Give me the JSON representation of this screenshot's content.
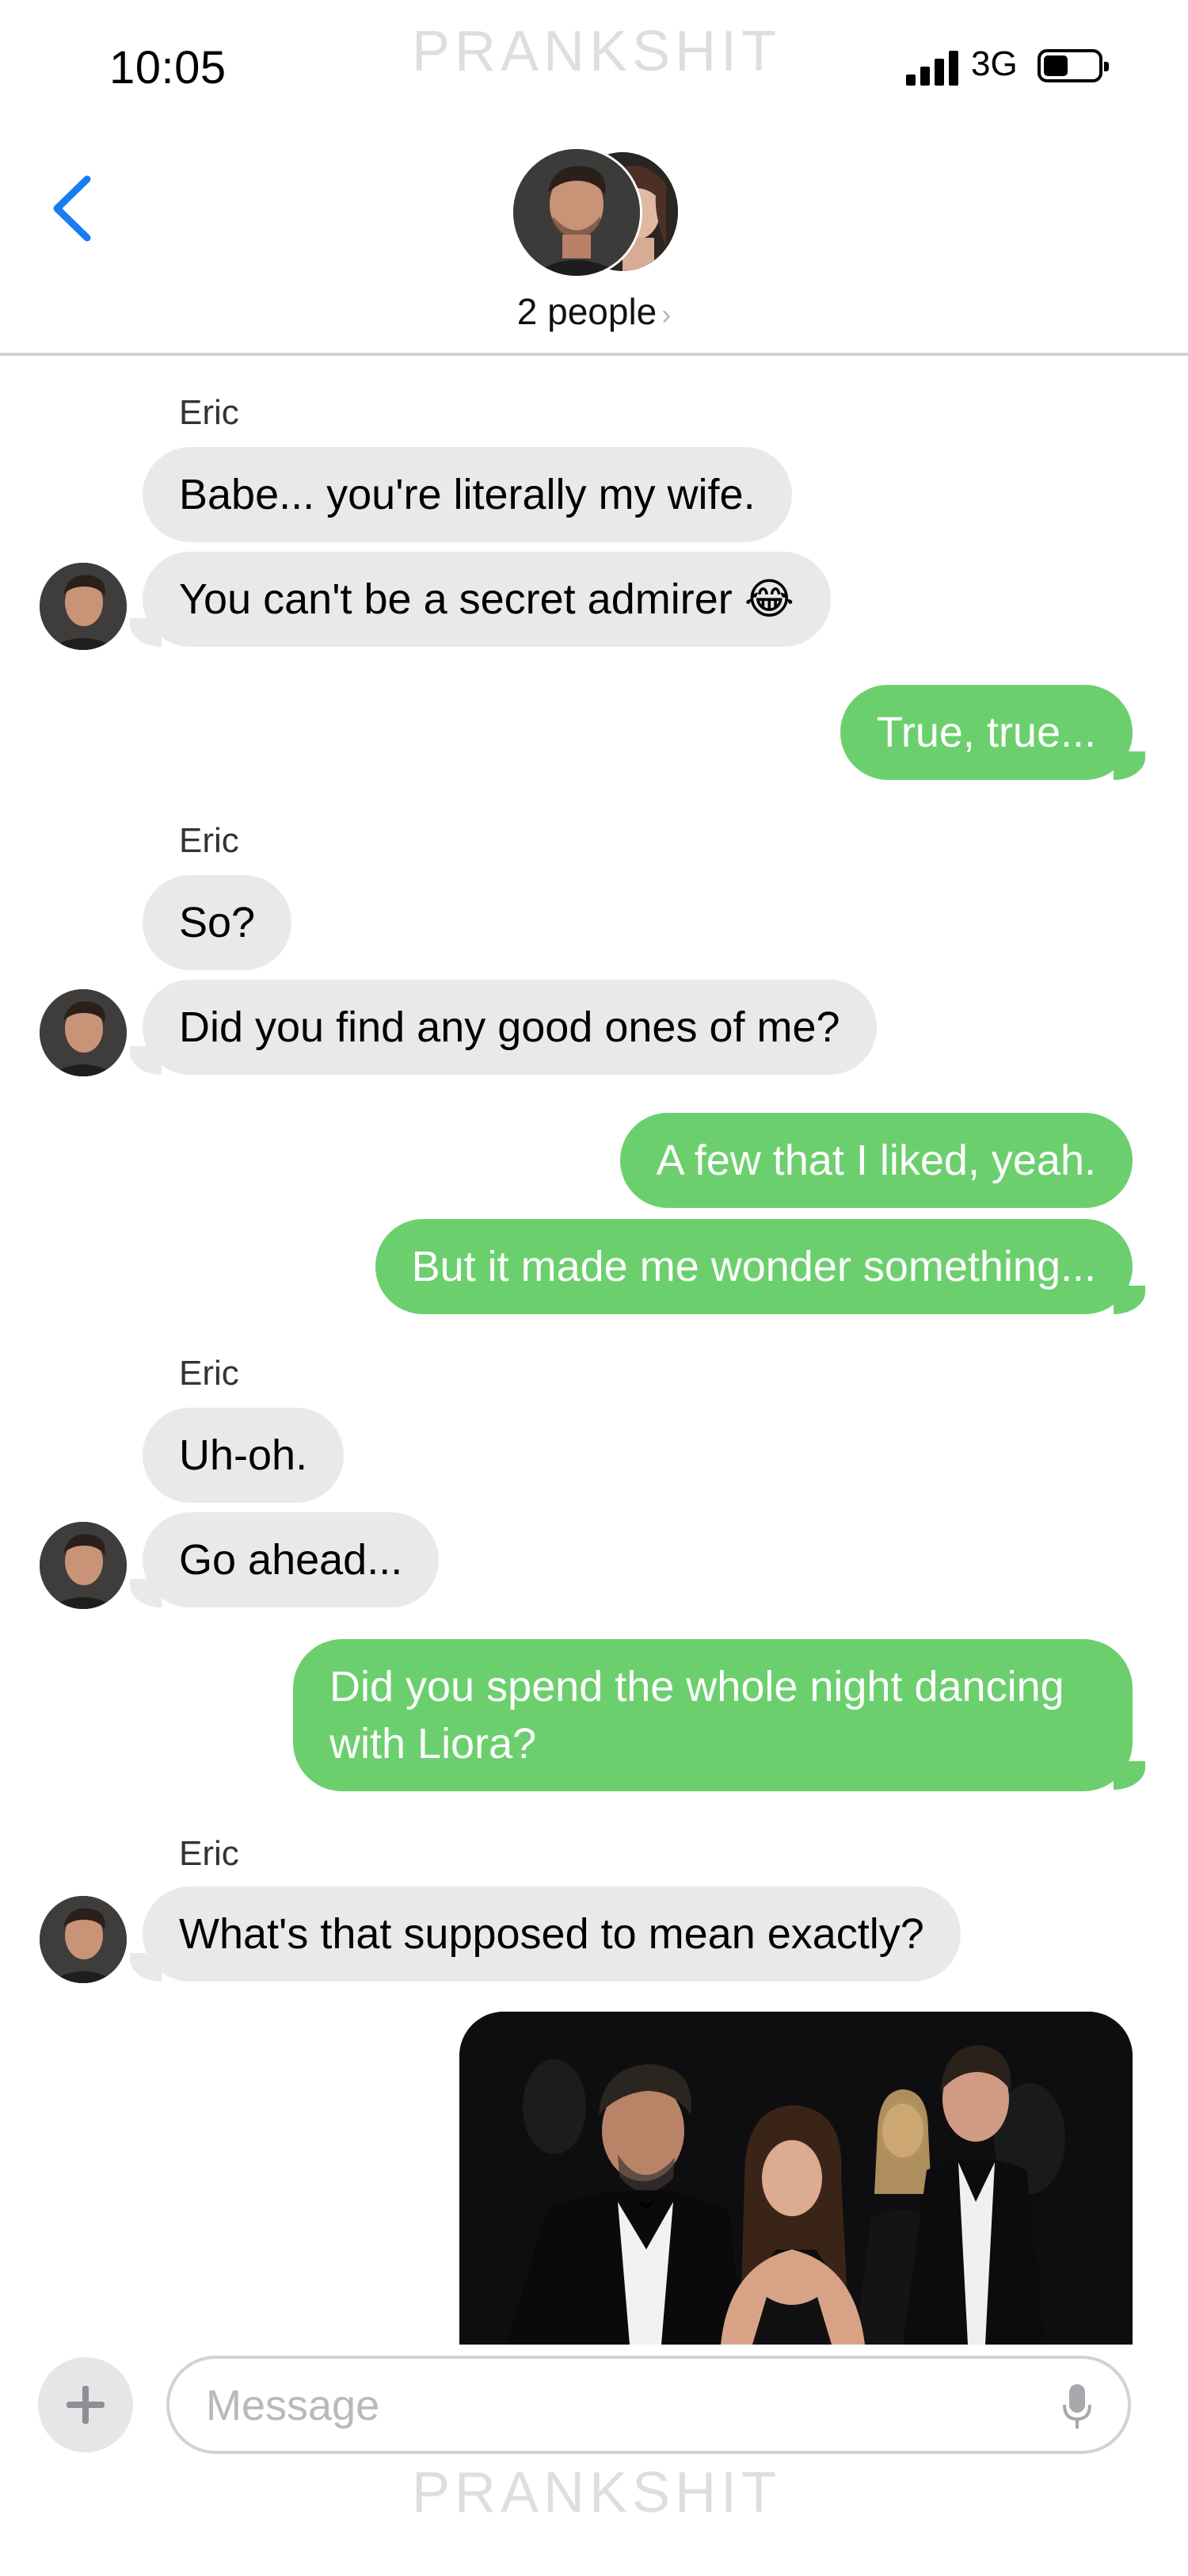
{
  "status_bar": {
    "time": "10:05",
    "network": "3G"
  },
  "watermark": "PRANKSHIT",
  "header": {
    "subtitle": "2 people",
    "chevron": "›"
  },
  "messages": [
    {
      "from": "Eric",
      "sender_label": "Eric",
      "text": "Babe... you're literally my wife."
    },
    {
      "from": "Eric",
      "text": "You can't be a secret admirer 😂"
    },
    {
      "from": "me",
      "text": "True, true..."
    },
    {
      "from": "Eric",
      "sender_label": "Eric",
      "text": "So?"
    },
    {
      "from": "Eric",
      "text": "Did you find any good ones of me?"
    },
    {
      "from": "me",
      "text": "A few that I liked, yeah."
    },
    {
      "from": "me",
      "text": "But it made me wonder something..."
    },
    {
      "from": "Eric",
      "sender_label": "Eric",
      "text": "Uh-oh."
    },
    {
      "from": "Eric",
      "text": "Go ahead..."
    },
    {
      "from": "me",
      "text": "Did you spend the whole night dancing with Liora?"
    },
    {
      "from": "Eric",
      "sender_label": "Eric",
      "text": "What's that supposed to mean exactly?"
    },
    {
      "from": "me",
      "type": "photo"
    }
  ],
  "composer": {
    "placeholder": "Message"
  },
  "icons": {
    "back": "chevron-left-icon",
    "add": "plus-icon",
    "mic": "microphone-icon",
    "signal": "cellular-signal-icon",
    "battery": "battery-icon"
  },
  "colors": {
    "outgoing_bubble": "#6ccf6e",
    "incoming_bubble": "#e9e9eb",
    "accent": "#1a7cf5"
  }
}
